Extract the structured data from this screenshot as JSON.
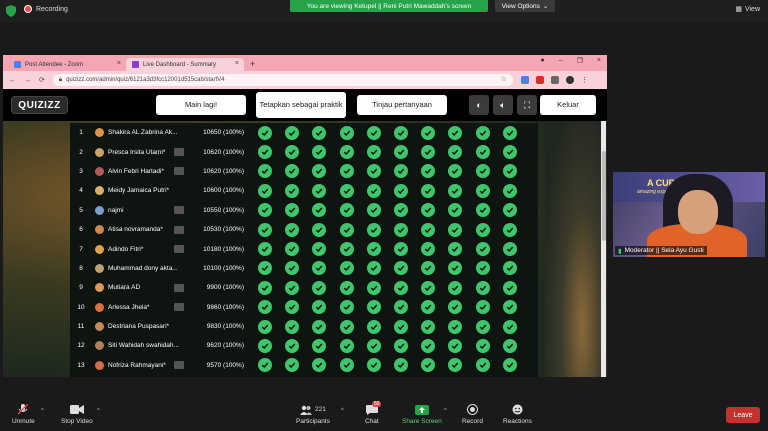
{
  "zoom": {
    "recording_label": "Recording",
    "viewing_banner": "You are viewing Ketupel || Reni Putri Mawaddah's screen",
    "view_options": "View Options",
    "view_label": "View",
    "toolbar": {
      "unmute": "Unmute",
      "stop_video": "Stop Video",
      "participants": "Participants",
      "participants_count": "221",
      "chat": "Chat",
      "chat_badge": "50",
      "share_screen": "Share Screen",
      "record": "Record",
      "reactions": "Reactions",
      "leave": "Leave"
    },
    "video_tile": {
      "banner": "A CUP O",
      "banner_sub": "amazing experie",
      "participant_label": "Moderator || Sela Ayu Gusti"
    }
  },
  "browser": {
    "tabs": [
      {
        "label": "Post Attendee - Zoom",
        "color": "#2d8cff"
      },
      {
        "label": "Live Dashboard - Summary",
        "color": "#8b3bd6"
      }
    ],
    "url": "quizizz.com/admin/quiz/6121a3d3fcc12001d515cab/startV4"
  },
  "quizizz": {
    "logo": "QUIZIZZ",
    "buttons": {
      "play_again": "Main lagi!",
      "set_practice": "Tetapkan sebagai praktik",
      "review_questions": "Tinjau pertanyaan",
      "exit": "Keluar"
    },
    "accent": "#3fc56b",
    "participants": [
      {
        "rank": "1",
        "name": "Shakira AL Zabrina Ak...",
        "score": "10650 (100%)",
        "mail": false,
        "avatar": "#d9944a"
      },
      {
        "rank": "2",
        "name": "Presca Irsita Utami*",
        "score": "10620 (100%)",
        "mail": true,
        "avatar": "#c9a36a"
      },
      {
        "rank": "3",
        "name": "Alvin Febri Hartadi*",
        "score": "10620 (100%)",
        "mail": true,
        "avatar": "#b55a5a"
      },
      {
        "rank": "4",
        "name": "Meidy Jamaica Putri*",
        "score": "10600 (100%)",
        "mail": false,
        "avatar": "#d9b06a"
      },
      {
        "rank": "5",
        "name": "najmi",
        "score": "10550 (100%)",
        "mail": true,
        "avatar": "#7aa0c9"
      },
      {
        "rank": "6",
        "name": "Atisa novramanda*",
        "score": "10530 (100%)",
        "mail": true,
        "avatar": "#d0874a"
      },
      {
        "rank": "7",
        "name": "Adindo Fitri*",
        "score": "10180 (100%)",
        "mail": true,
        "avatar": "#e0a24a"
      },
      {
        "rank": "8",
        "name": "Muhammad dony akta...",
        "score": "10100 (100%)",
        "mail": false,
        "avatar": "#c0a070"
      },
      {
        "rank": "9",
        "name": "Mutiara AD",
        "score": "9900 (100%)",
        "mail": true,
        "avatar": "#d99a5a"
      },
      {
        "rank": "10",
        "name": "Arlessa Jhela*",
        "score": "9860 (100%)",
        "mail": true,
        "avatar": "#e0703a"
      },
      {
        "rank": "11",
        "name": "Destriana Puspasari*",
        "score": "9830 (100%)",
        "mail": false,
        "avatar": "#c58a5a"
      },
      {
        "rank": "12",
        "name": "Siti Wahidah swahidah...",
        "score": "9620 (100%)",
        "mail": false,
        "avatar": "#b0805a"
      },
      {
        "rank": "13",
        "name": "Nofriza Rahmayani*",
        "score": "9570 (100%)",
        "mail": true,
        "avatar": "#d96a4a"
      }
    ]
  }
}
